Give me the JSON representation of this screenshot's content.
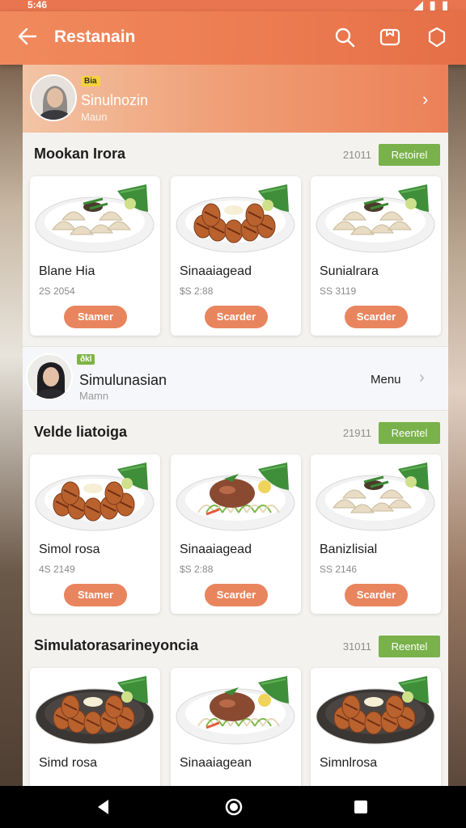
{
  "status_bar": {
    "time": "5:46",
    "icons": "◢ ▮ ▮"
  },
  "app_bar": {
    "title": "Restanain"
  },
  "profile_top": {
    "badge": "Bia",
    "name": "Sinulnozin",
    "subtitle": "Maun"
  },
  "sections": [
    {
      "title": "Mookan Irora",
      "count": "21011",
      "button": "Retoirel",
      "cards": [
        {
          "name": "Blane Hia",
          "price": "2S 2054",
          "button": "Stamer",
          "dish": "dumplings"
        },
        {
          "name": "Sinaaiagead",
          "price": "$S 2:88",
          "button": "Scarder",
          "dish": "skewers"
        },
        {
          "name": "Sunialrara",
          "price": "SS 3119",
          "button": "Scarder",
          "dish": "dumplings"
        }
      ]
    },
    {
      "title": "Velde liatoiga",
      "count": "21911",
      "button": "Reentel",
      "cards": [
        {
          "name": "Simol rosa",
          "price": "4S 2149",
          "button": "Stamer",
          "dish": "skewers"
        },
        {
          "name": "Sinaaiagead",
          "price": "$S 2:88",
          "button": "Scarder",
          "dish": "noodles"
        },
        {
          "name": "Banizlisial",
          "price": "SS 2146",
          "button": "Scarder",
          "dish": "dumplings"
        }
      ]
    },
    {
      "title": "Simulatorasarineyoncia",
      "count": "31011",
      "button": "Reentel",
      "cards": [
        {
          "name": "Simd rosa",
          "price": "",
          "button": "",
          "dish": "skewers-dark"
        },
        {
          "name": "Sinaaiagean",
          "price": "",
          "button": "",
          "dish": "noodles"
        },
        {
          "name": "Simnlrosa",
          "price": "",
          "button": "",
          "dish": "skewers-dark"
        }
      ]
    }
  ],
  "profile_mid": {
    "badge": "ðkl",
    "name": "Simulunasian",
    "subtitle": "Mamn",
    "menu_label": "Menu"
  },
  "icons": {
    "back": "arrow-left-icon",
    "search": "search-icon",
    "bookmark": "bookmark-icon",
    "settings": "gear-icon",
    "nav_back": "triangle-back-icon",
    "nav_home": "circle-home-icon",
    "nav_recent": "square-recent-icon"
  },
  "colors": {
    "accent": "#ec7b50",
    "button_orange": "#e9855e",
    "button_green": "#79b14a",
    "badge_yellow": "#f5d23a"
  }
}
